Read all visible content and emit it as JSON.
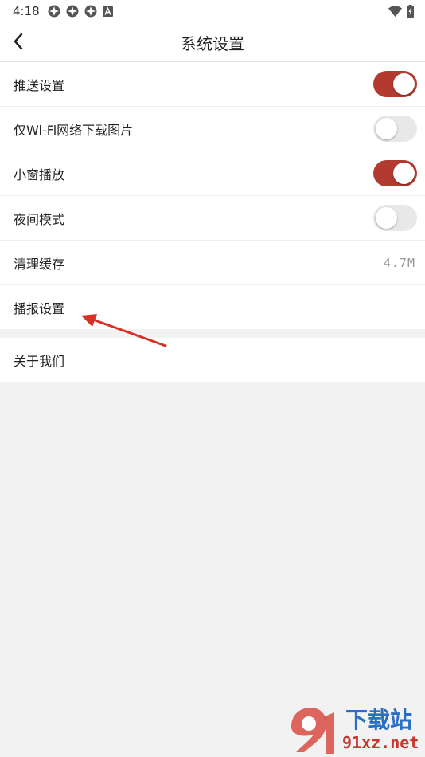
{
  "status_bar": {
    "time": "4:18",
    "left_icons": [
      "notification-icon",
      "notification-icon",
      "notification-icon",
      "a-icon"
    ],
    "right_icons": [
      "wifi-icon",
      "battery-icon"
    ]
  },
  "header": {
    "title": "系统设置",
    "back_icon": "chevron-left-icon"
  },
  "settings": {
    "items": [
      {
        "label": "推送设置",
        "control": "toggle",
        "on": true
      },
      {
        "label": "仅Wi-Fi网络下载图片",
        "control": "toggle",
        "on": false
      },
      {
        "label": "小窗播放",
        "control": "toggle",
        "on": true
      },
      {
        "label": "夜间模式",
        "control": "toggle",
        "on": false
      },
      {
        "label": "清理缓存",
        "control": "value",
        "value": "4.7M"
      },
      {
        "label": "播报设置",
        "control": "none"
      }
    ]
  },
  "about": {
    "label": "关于我们"
  },
  "watermark": {
    "main": "下载站",
    "sub": "91xz.net"
  },
  "colors": {
    "toggle_on": "#b33a2f",
    "toggle_off": "#e8e8e8",
    "annotation_arrow": "#d93025",
    "background": "#f2f2f2"
  }
}
